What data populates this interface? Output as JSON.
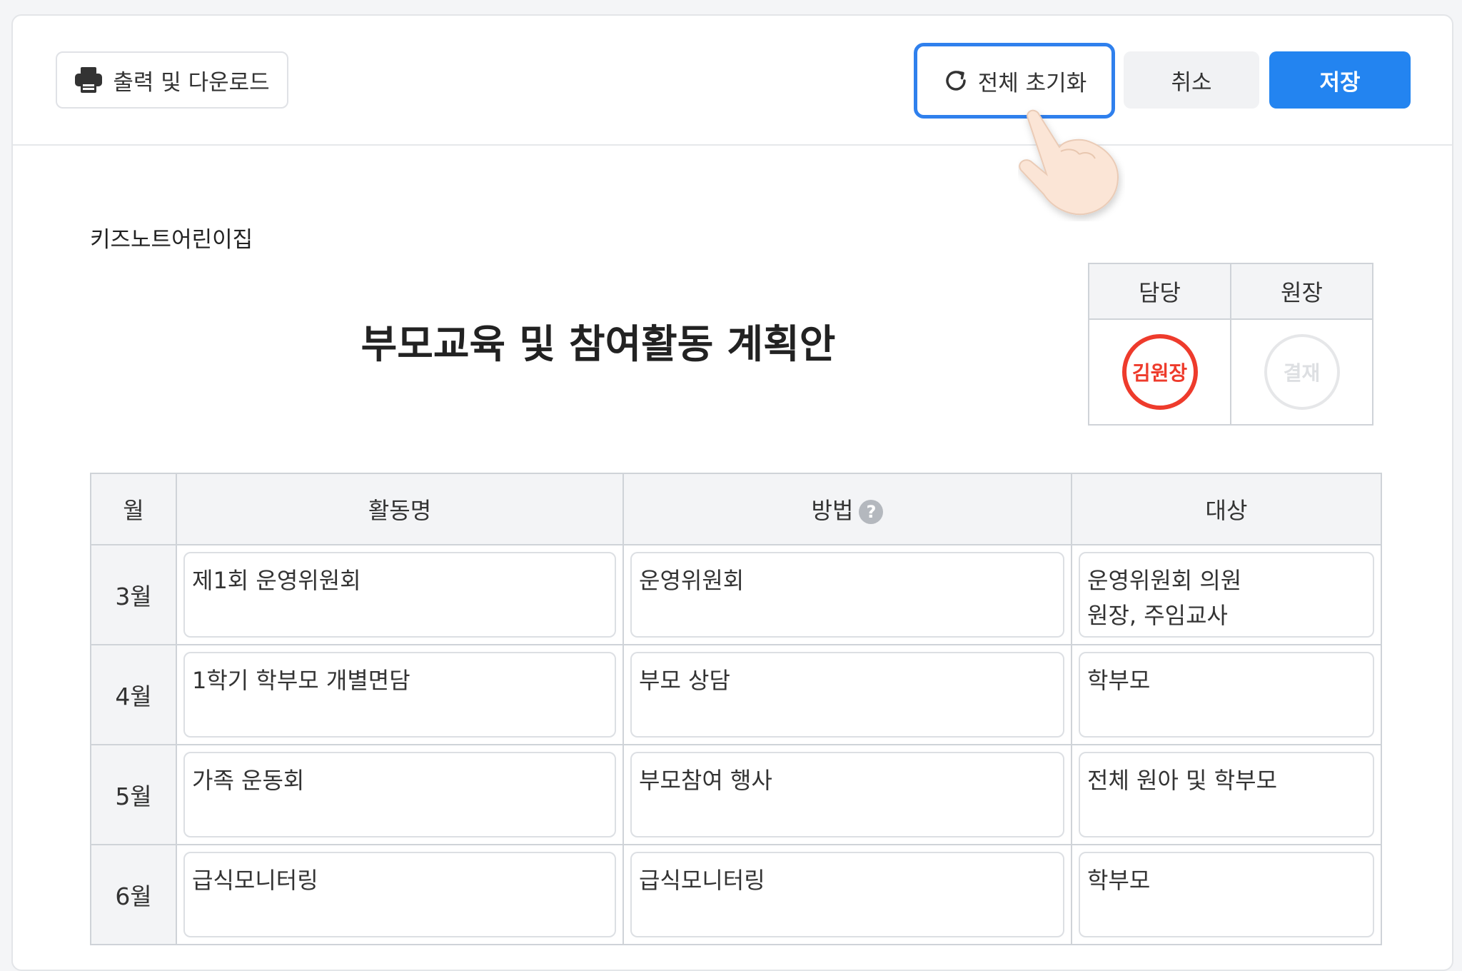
{
  "toolbar": {
    "print_label": "출력 및 다운로드",
    "reset_label": "전체 초기화",
    "cancel_label": "취소",
    "save_label": "저장"
  },
  "document": {
    "org_name": "키즈노트어린이집",
    "title": "부모교육 및 참여활동 계획안"
  },
  "approval": {
    "headers": [
      "담당",
      "원장"
    ],
    "stamps": [
      "김원장",
      "결재"
    ]
  },
  "plan_table": {
    "headers": {
      "month": "월",
      "activity": "활동명",
      "method": "방법",
      "target": "대상"
    },
    "rows": [
      {
        "month": "3월",
        "activity": "제1회 운영위원회",
        "method": "운영위원회",
        "target": "운영위원회 의원\n원장, 주임교사"
      },
      {
        "month": "4월",
        "activity": "1학기 학부모 개별면담",
        "method": "부모 상담",
        "target": "학부모"
      },
      {
        "month": "5월",
        "activity": "가족 운동회",
        "method": "부모참여 행사",
        "target": "전체 원아 및 학부모"
      },
      {
        "month": "6월",
        "activity": "급식모니터링",
        "method": "급식모니터링",
        "target": "학부모"
      }
    ]
  },
  "colors": {
    "primary": "#2384f0",
    "focus_ring": "#2f80ed",
    "stamp_red": "#ee3b2c",
    "stamp_empty": "#e6e7e9"
  }
}
